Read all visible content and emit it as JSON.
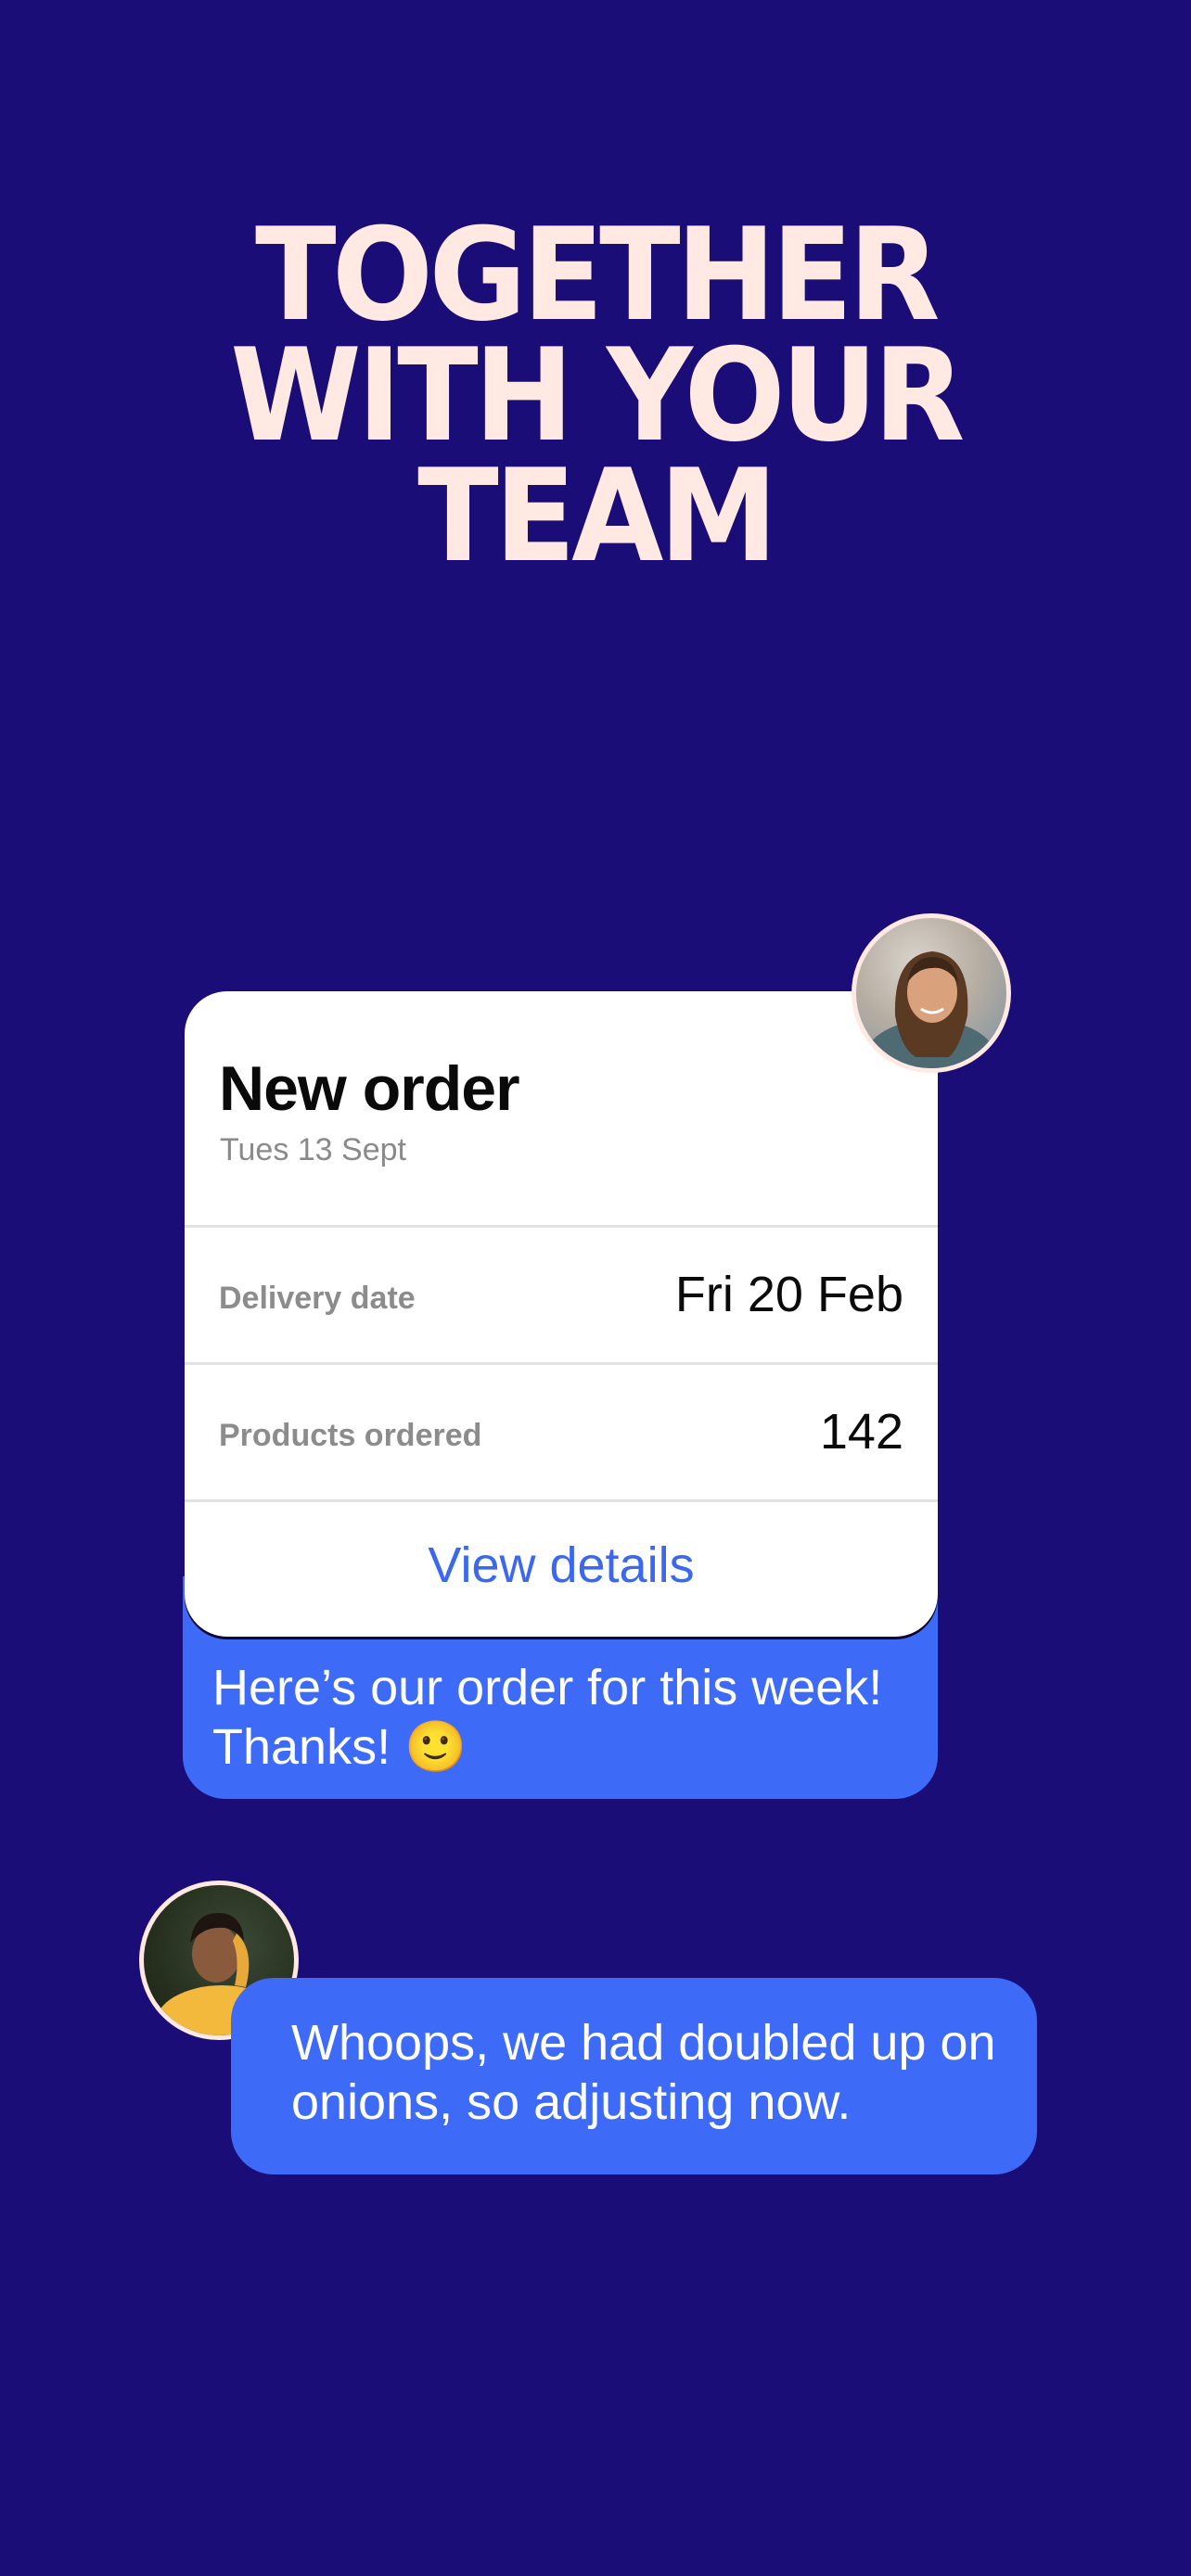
{
  "headline": {
    "line1": "TOGETHER",
    "line2": "WITH YOUR",
    "line3": "TEAM"
  },
  "order_card": {
    "title": "New order",
    "date": "Tues 13 Sept",
    "rows": [
      {
        "label": "Delivery date",
        "value": "Fri 20 Feb"
      },
      {
        "label": "Products ordered",
        "value": "142"
      }
    ],
    "action_label": "View details"
  },
  "messages": [
    {
      "text": "Here’s our order for this week! Thanks! 🙂"
    },
    {
      "text": "Whoops, we had doubled up on onions, so adjusting now."
    }
  ],
  "colors": {
    "background": "#1b0d78",
    "headline": "#ffe9e2",
    "bubble": "#3d6af7",
    "link": "#3b68ee"
  }
}
